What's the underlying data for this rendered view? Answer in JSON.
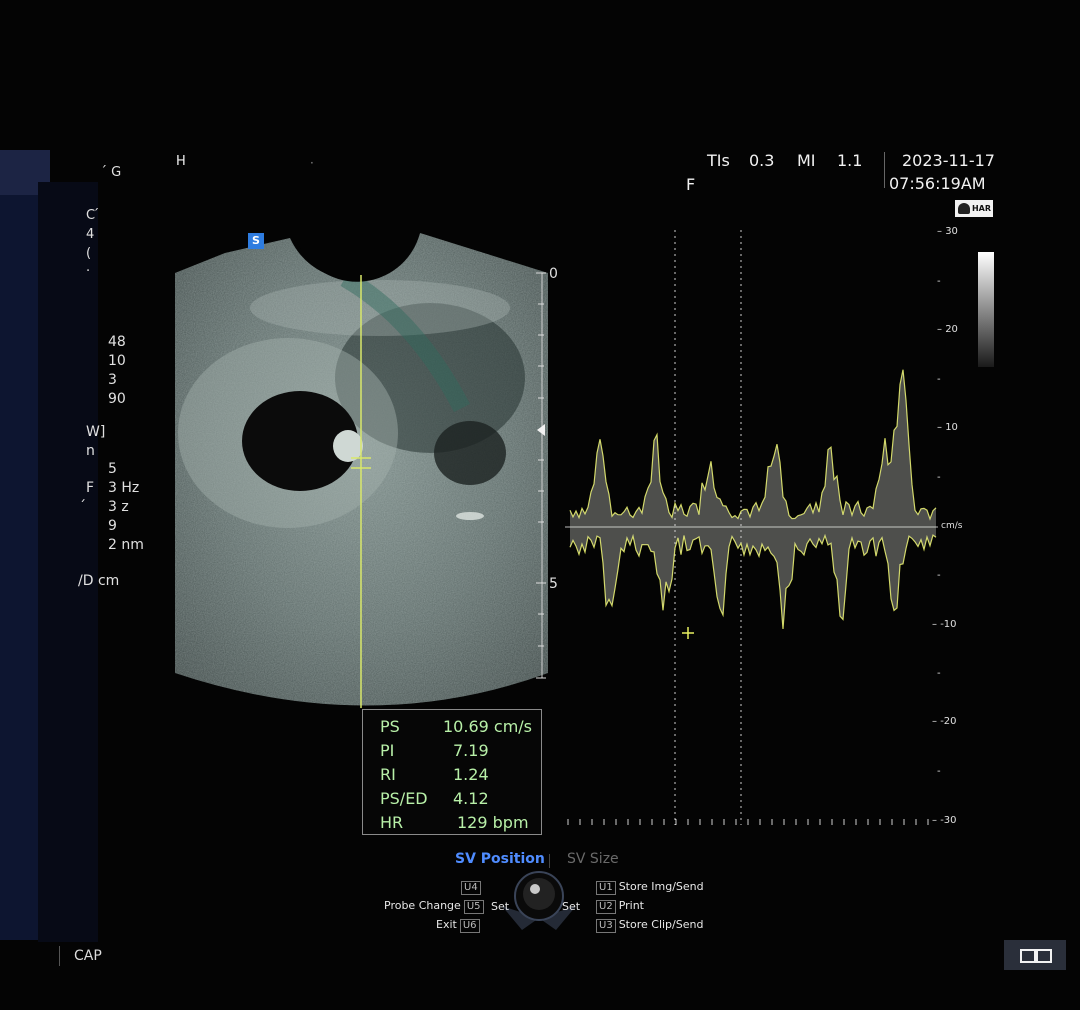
{
  "header": {
    "title_fragment": "H",
    "subtitle_fragment": "·",
    "ti_label": "TIs",
    "ti_value": "0.3",
    "mi_label": "MI",
    "mi_value": "1.1",
    "date": "2023-11-17",
    "time": "07:56:19AM",
    "focus_marker": "F",
    "har_badge": "HAR",
    "sv_badge": "S"
  },
  "left_params": {
    "partial_top": [
      "C ́",
      "4",
      "(",
      "·"
    ],
    "values": [
      "48",
      "10",
      "3",
      "90"
    ],
    "doppler": [
      "W]",
      "n",
      "5",
      "3   Hz",
      "3   z",
      "9",
      "2   nm"
    ],
    "fragment_f": "F",
    "fragment_tick": "́",
    "depth_label": "/D      cm",
    "corner_glyph": "́ G"
  },
  "depth_scale": {
    "labels": [
      "0",
      "5"
    ]
  },
  "velocity_scale": {
    "unit": "cm/s",
    "labels": [
      "30",
      "20",
      "10",
      "-10",
      "-20",
      "-30"
    ]
  },
  "measurements": [
    {
      "label": "PS",
      "value": "10.69 cm/s"
    },
    {
      "label": "PI",
      "value": "7.19"
    },
    {
      "label": "RI",
      "value": "1.24"
    },
    {
      "label": "PS/ED",
      "value": "4.12"
    },
    {
      "label": "HR",
      "value": "129 bpm"
    }
  ],
  "softkeys": {
    "active": "SV Position",
    "inactive": "SV Size"
  },
  "controls": {
    "u4": "U4",
    "probe_change": "Probe Change",
    "u5": "U5",
    "exit": "Exit",
    "u6": "U6",
    "set_left": "Set",
    "set_right": "Set",
    "u1": "U1",
    "store_img": "Store Img/Send",
    "u2": "U2",
    "print": "Print",
    "u3": "U3",
    "store_clip": "Store Clip/Send"
  },
  "footer": {
    "cap_label": "CAP"
  },
  "colors": {
    "measurement_text": "#b8f0a8",
    "doppler_trace": "#e8f060",
    "softkey_active": "#4f8cff",
    "softkey_inactive": "#6a6a6a",
    "sidebar": "#0d1530"
  }
}
